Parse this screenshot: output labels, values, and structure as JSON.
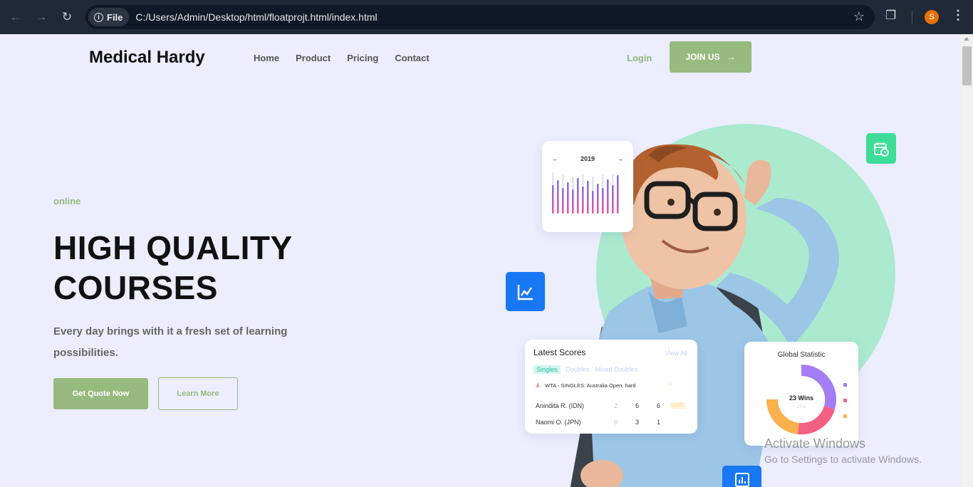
{
  "browser": {
    "chip_label": "File",
    "url": "C:/Users/Admin/Desktop/html/floatprojt.html/index.html",
    "profile_initial": "S"
  },
  "nav": {
    "brand": "Medical Hardy",
    "links": [
      "Home",
      "Product",
      "Pricing",
      "Contact"
    ],
    "login": "Login",
    "join": "JOIN US"
  },
  "hero": {
    "eyebrow": "online",
    "headline_line1": "HIGH QUALITY",
    "headline_line2": "COURSES",
    "subtitle": "Every day brings with it a fresh set of learning possibilities.",
    "primary_button": "Get Quote Now",
    "secondary_button": "Learn More"
  },
  "chart_card": {
    "prev": "←",
    "year": "2019",
    "next": "→"
  },
  "scores_card": {
    "title": "Latest Scores",
    "view_all": "View All",
    "tabs": [
      "Singles",
      "Doubles",
      "Mixed Doubles"
    ],
    "match": "WTA - SINGLES: Australia Open, hard",
    "rows": [
      {
        "player": "Anindita R. (IDN)",
        "s1": "2",
        "s2": "6",
        "s3": "6",
        "badge": "LIVE"
      },
      {
        "player": "Naomi O. (JPN)",
        "s1": "0",
        "s2": "3",
        "s3": "1"
      }
    ]
  },
  "global_card": {
    "title": "Global Statistic",
    "center": "23 Wins",
    "center_sub": "23%"
  },
  "watermark": {
    "line1": "Activate Windows",
    "line2": "Go to Settings to activate Windows."
  },
  "colors": {
    "accent": "#97ba7f",
    "page_bg": "#ecedfd",
    "mint_circle": "#abeacf",
    "tile_blue": "#1877f2",
    "tile_green": "#3ddc97"
  }
}
